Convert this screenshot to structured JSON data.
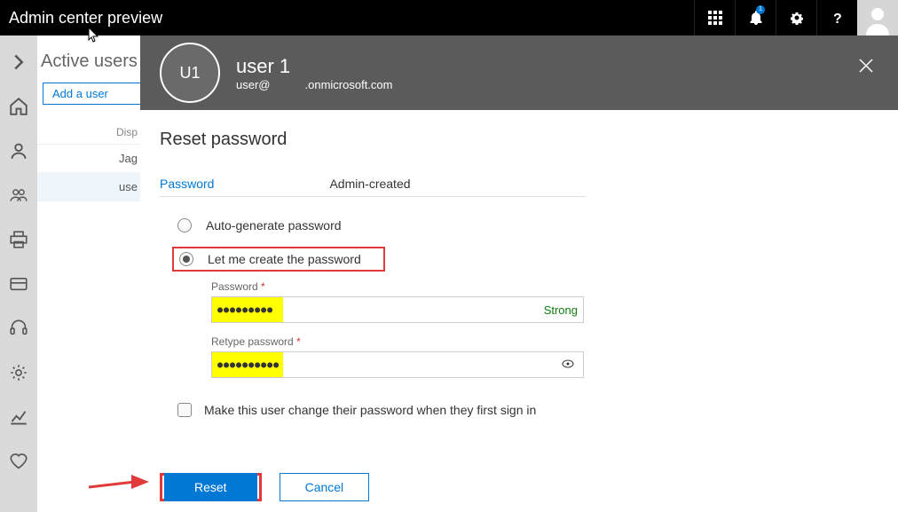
{
  "topbar": {
    "title": "Admin center preview"
  },
  "rail": {
    "icons": [
      "home",
      "user",
      "users",
      "printer",
      "card",
      "headset",
      "gear",
      "chart",
      "heart"
    ]
  },
  "bg": {
    "title": "Active users",
    "add": "Add a user",
    "display_col": "Disp",
    "rows": [
      "Jag",
      "use"
    ]
  },
  "panel": {
    "avatar_initials": "U1",
    "user_name": "user 1",
    "user_email_prefix": "user@",
    "user_email_domain": ".onmicrosoft.com",
    "section_title": "Reset password",
    "tab_password": "Password",
    "tab_value": "Admin-created",
    "opt_auto": "Auto-generate password",
    "opt_manual": "Let me create the password",
    "pwd_label": "Password",
    "retype_label": "Retype password",
    "asterisk": "*",
    "pwd_dots": "●●●●●●●●●",
    "retype_dots": "●●●●●●●●●●",
    "strength": "Strong",
    "check_label": "Make this user change their password when they first sign in",
    "btn_reset": "Reset",
    "btn_cancel": "Cancel"
  }
}
